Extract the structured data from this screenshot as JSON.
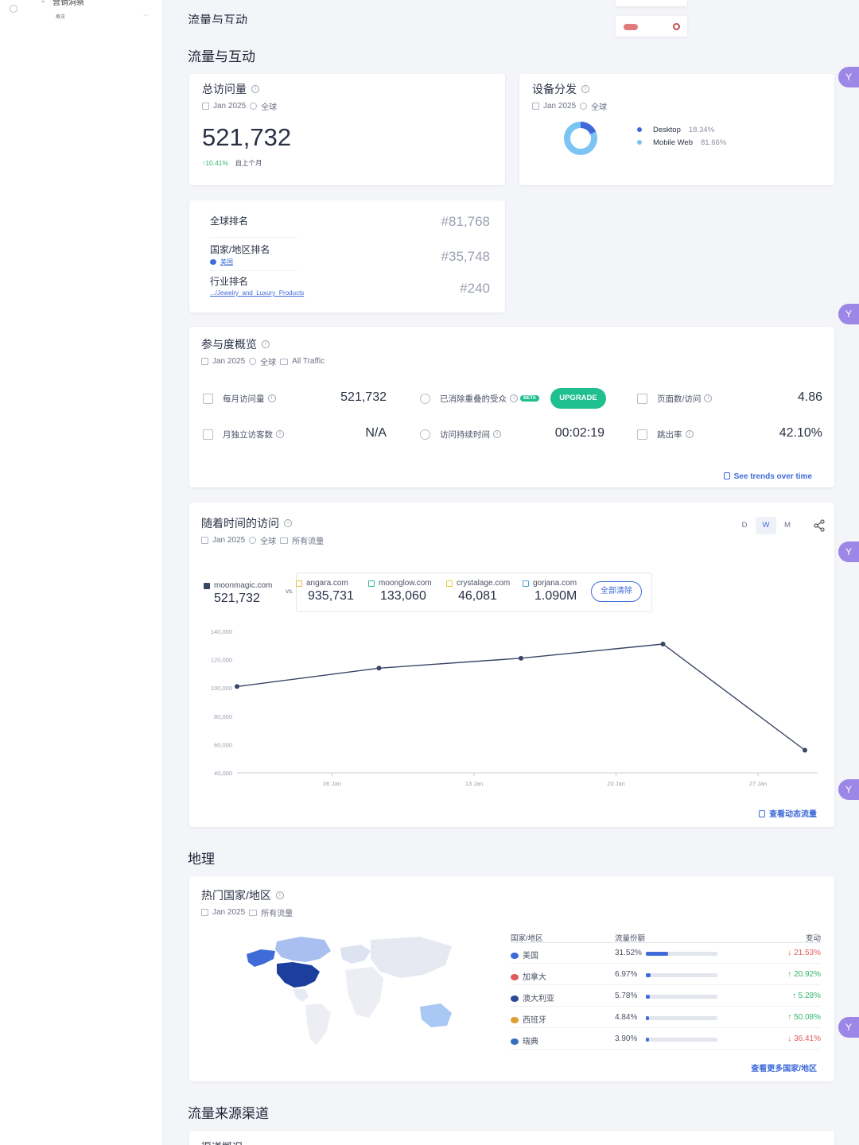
{
  "sidebar": {
    "top_label": "营销洞察",
    "top_sub": "概览"
  },
  "header": {
    "cut_title": "流量与互动"
  },
  "traffic": {
    "section_title": "流量与互动",
    "total_visits": {
      "title": "总访问量",
      "date": "Jan 2025",
      "region": "全球",
      "value": "521,732",
      "change": "↑10.41%",
      "change_label": "自上个月"
    },
    "device": {
      "title": "设备分发",
      "date": "Jan 2025",
      "region": "全球",
      "items": [
        {
          "name": "Desktop",
          "pct": "18.34%",
          "value": 18.34,
          "color": "#3f6bd8"
        },
        {
          "name": "Mobile Web",
          "pct": "81.66%",
          "value": 81.66,
          "color": "#7cc4f4"
        }
      ]
    },
    "ranks": [
      {
        "label": "全球排名",
        "sub": "",
        "value": "#81,768"
      },
      {
        "label": "国家/地区排名",
        "sub": "美国",
        "value": "#35,748"
      },
      {
        "label": "行业排名",
        "sub": ".../Jewelry_and_Luxury_Products",
        "value": "#240"
      }
    ]
  },
  "engagement": {
    "title": "参与度概览",
    "date": "Jan 2025",
    "region": "全球",
    "traffic": "All Traffic",
    "monthly_visits_label": "每月访问量",
    "monthly_visits": "521,732",
    "dedup_label": "已消除重叠的受众",
    "beta": "BETA",
    "upgrade": "UPGRADE",
    "pages_label": "页面数/访问",
    "pages": "4.86",
    "unique_label": "月独立访客数",
    "unique": "N/A",
    "duration_label": "访问持续时间",
    "duration": "00:02:19",
    "bounce_label": "跳出率",
    "bounce": "42.10%",
    "trends_link": "See trends over time"
  },
  "visits_over_time": {
    "title": "随着时间的访问",
    "date": "Jan 2025",
    "region": "全球",
    "traffic": "所有流量",
    "granularity": [
      "D",
      "W",
      "M"
    ],
    "selected": "W",
    "main_site": {
      "name": "moonmagic.com",
      "value": "521,732"
    },
    "vs": "vs.",
    "competitors": [
      {
        "name": "angara.com",
        "value": "935,731",
        "color": "#f0b84a"
      },
      {
        "name": "moonglow.com",
        "value": "133,060",
        "color": "#34b99a"
      },
      {
        "name": "crystalage.com",
        "value": "46,081",
        "color": "#e8c93a"
      },
      {
        "name": "gorjana.com",
        "value": "1.090M",
        "color": "#4aa3df"
      }
    ],
    "clear_all": "全部清除",
    "link": "查看动态流量"
  },
  "chart_data": {
    "type": "line",
    "x": [
      "Jan 01",
      "Jan 06",
      "Jan 13",
      "Jan 20",
      "Jan 27"
    ],
    "x_ticks": [
      "06 Jan",
      "13 Jan",
      "20 Jan",
      "27 Jan"
    ],
    "series": [
      {
        "name": "moonmagic.com",
        "values": [
          101000,
          114000,
          121000,
          131000,
          56000
        ]
      }
    ],
    "y_ticks": [
      "140,000",
      "120,000",
      "100,000",
      "80,000",
      "60,000",
      "40,000"
    ],
    "ylim": [
      40000,
      140000
    ],
    "grid": false
  },
  "geo": {
    "section_title": "地理",
    "title": "热门国家/地区",
    "date": "Jan 2025",
    "traffic": "所有流量",
    "headers": [
      "国家/地区",
      "流量份额",
      "变动"
    ],
    "rows": [
      {
        "country": "美国",
        "share": "31.52%",
        "share_value": 31.52,
        "change": "21.53%",
        "dir": "down",
        "flag": "#3f6bd8"
      },
      {
        "country": "加拿大",
        "share": "6.97%",
        "share_value": 6.97,
        "change": "20.92%",
        "dir": "up",
        "flag": "#e05a5a"
      },
      {
        "country": "澳大利亚",
        "share": "5.78%",
        "share_value": 5.78,
        "change": "5.28%",
        "dir": "up",
        "flag": "#2c4a9a"
      },
      {
        "country": "西班牙",
        "share": "4.84%",
        "share_value": 4.84,
        "change": "50.08%",
        "dir": "up",
        "flag": "#e0a030"
      },
      {
        "country": "瑞典",
        "share": "3.90%",
        "share_value": 3.9,
        "change": "36.41%",
        "dir": "down",
        "flag": "#3a6fc0"
      }
    ],
    "link": "查看更多国家/地区"
  },
  "sources": {
    "section_title": "流量来源渠道",
    "cut_title": "渠道概况"
  }
}
